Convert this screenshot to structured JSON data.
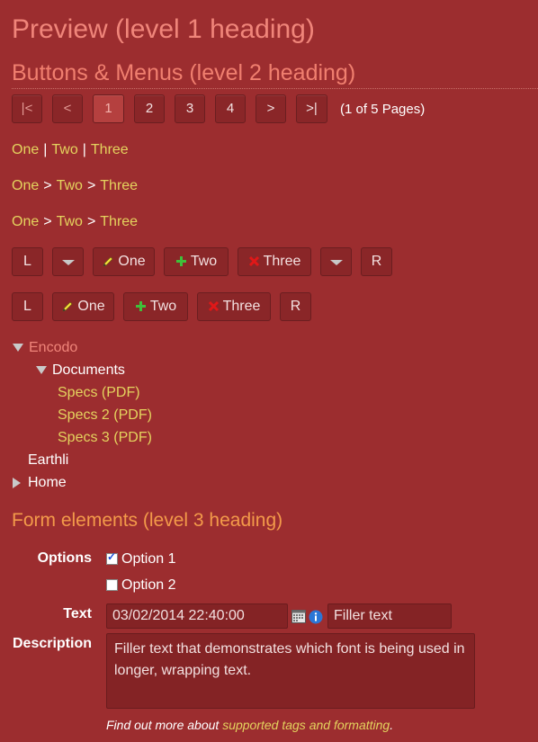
{
  "headings": {
    "h1": "Preview (level 1 heading)",
    "h2": "Buttons & Menus (level 2 heading)",
    "h3": "Form elements (level 3 heading)"
  },
  "pager": {
    "first": "|<",
    "prev": "<",
    "pages": [
      "1",
      "2",
      "3",
      "4"
    ],
    "next": ">",
    "last": ">|",
    "info": "(1 of 5 Pages)"
  },
  "menus": {
    "row1": [
      "One",
      "Two",
      "Three"
    ],
    "row1_sep": "|",
    "row2": [
      "One",
      "Two",
      "Three"
    ],
    "row2_sep": ">",
    "row3": [
      "One",
      "Two",
      "Three"
    ],
    "row3_sep": ">"
  },
  "toolbar1": {
    "left": "L",
    "one": "One",
    "two": "Two",
    "three": "Three",
    "right": "R"
  },
  "toolbar2": {
    "left": "L",
    "one": "One",
    "two": "Two",
    "three": "Three",
    "right": "R"
  },
  "tree": {
    "root": "Encodo",
    "folder": "Documents",
    "items": [
      "Specs (PDF)",
      "Specs 2 (PDF)",
      "Specs 3 (PDF)"
    ],
    "leaf": "Earthli",
    "home": "Home"
  },
  "form": {
    "options_label": "Options",
    "option1": "Option 1",
    "option2": "Option 2",
    "text_label": "Text",
    "date_value": "03/02/2014 22:40:00",
    "text_value": "Filler text",
    "description_label": "Description",
    "description_value": "Filler text that demonstrates which font is being used in longer, wrapping text.",
    "help_prefix": "Find out more about ",
    "help_link": "supported tags and formatting",
    "help_suffix": "."
  },
  "colors": {
    "background": "#9c2d2f",
    "link": "#e4d35e",
    "h1": "#f0857a",
    "h3": "#f39a4a"
  }
}
